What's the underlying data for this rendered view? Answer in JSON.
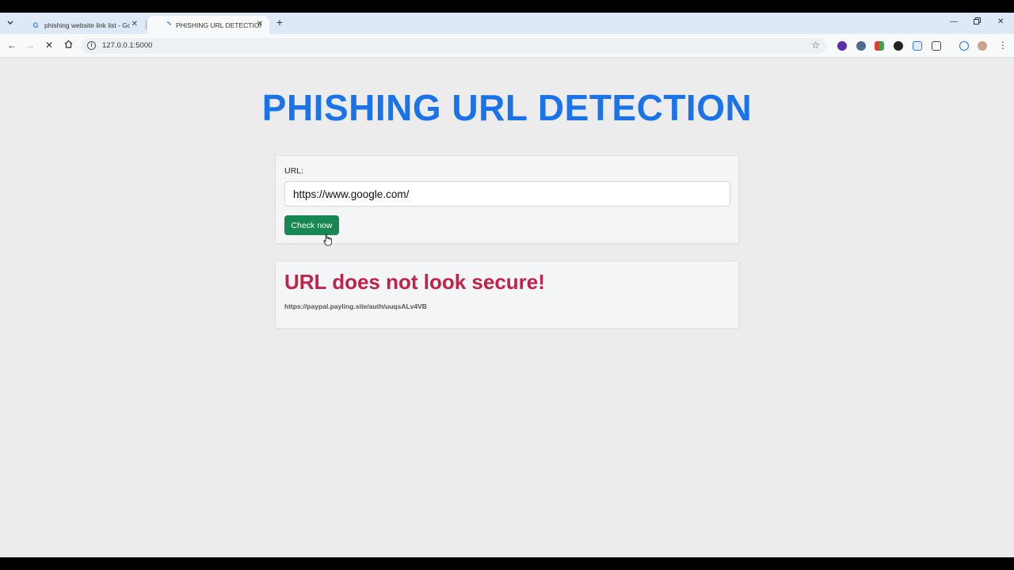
{
  "browser": {
    "tabs": [
      {
        "title": "phishing website link list - Goo",
        "favicon": "G",
        "active": false
      },
      {
        "title": "PHISHING URL DETECTION",
        "favicon": "loading-icon",
        "active": true
      }
    ],
    "address": "127.0.0.1:5000"
  },
  "page": {
    "title": "PHISHING URL DETECTION",
    "form": {
      "label": "URL:",
      "input_value": "https://www.google.com/",
      "button_label": "Check now"
    },
    "result": {
      "message": "URL does not look secure!",
      "url": "https://paypal.payling.site/auth/uuqsALv4VB",
      "message_color": "#c0224a"
    },
    "accent_color": "#1a73e8",
    "button_color": "#198754"
  }
}
